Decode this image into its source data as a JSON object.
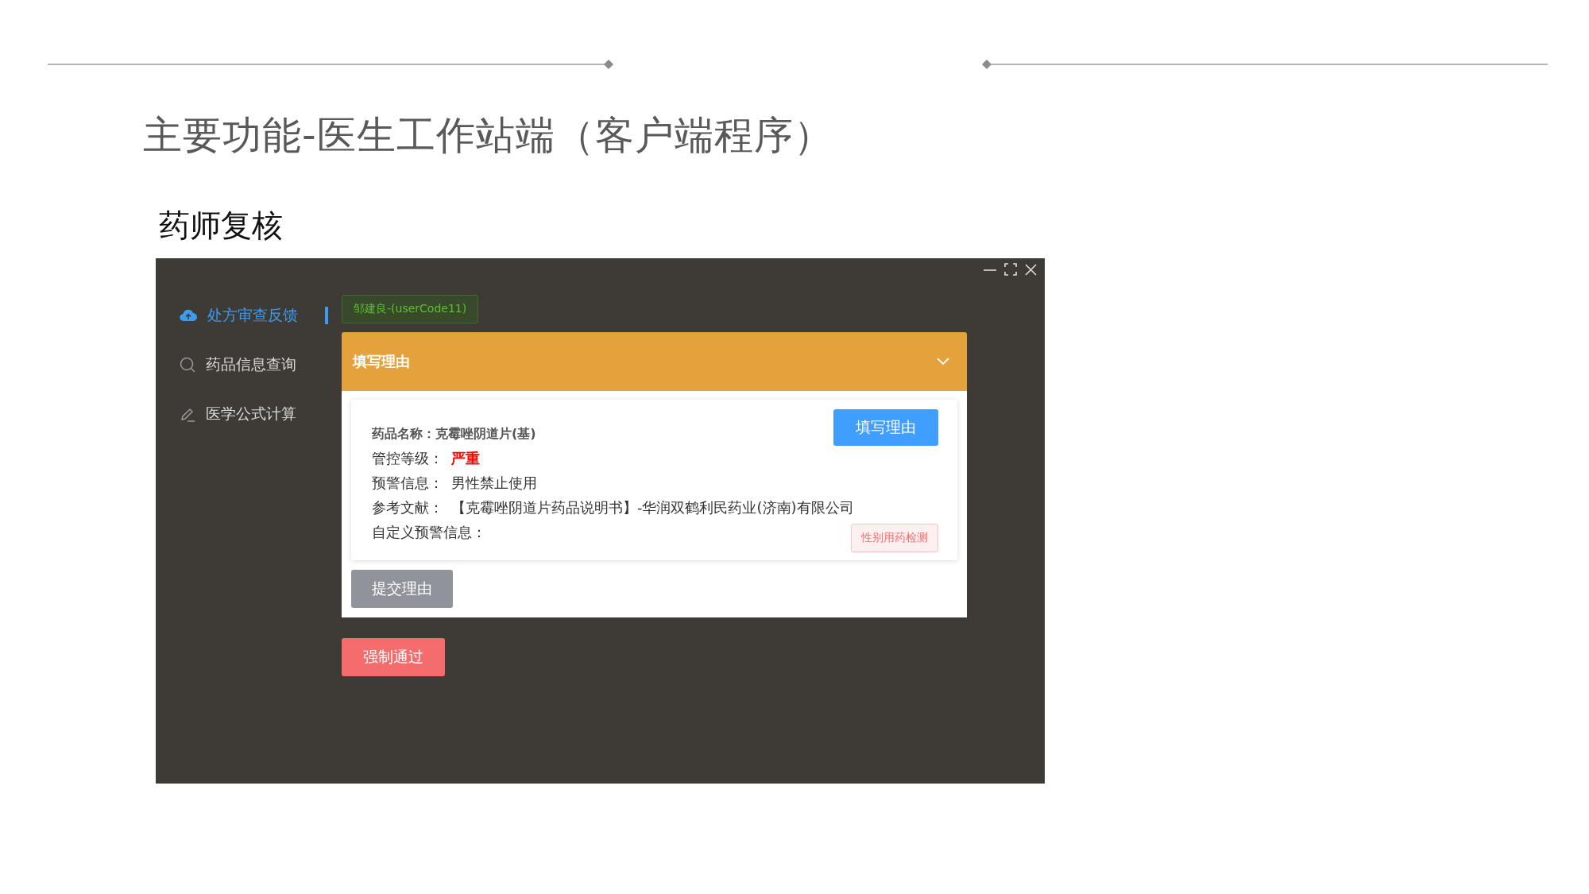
{
  "slide": {
    "title": "主要功能-医生工作站端（客户端程序）",
    "subtitle": "药师复核"
  },
  "app": {
    "sidebar": {
      "items": [
        {
          "label": "处方审查反馈",
          "selected": true
        },
        {
          "label": "药品信息查询",
          "selected": false
        },
        {
          "label": "医学公式计算",
          "selected": false
        }
      ]
    },
    "user_tag": "邹建良-(userCode11)",
    "panel": {
      "title": "填写理由",
      "expanded": true,
      "detail": {
        "drug_name": "药品名称：克霉唑阴道片(基)",
        "fill_button": "填写理由",
        "fields": [
          {
            "kind": "severity",
            "label": "管控等级：",
            "value": "严重"
          },
          {
            "kind": "plain",
            "label": "预警信息：",
            "value": "男性禁止使用"
          },
          {
            "kind": "plain",
            "label": "参考文献：",
            "value": "【克霉唑阴道片药品说明书】-华润双鹤利民药业(济南)有限公司"
          },
          {
            "kind": "empty",
            "label": "自定义预警信息："
          }
        ],
        "tag": "性别用药检测"
      },
      "submit_button": "提交理由"
    },
    "force_button": "强制通过"
  }
}
